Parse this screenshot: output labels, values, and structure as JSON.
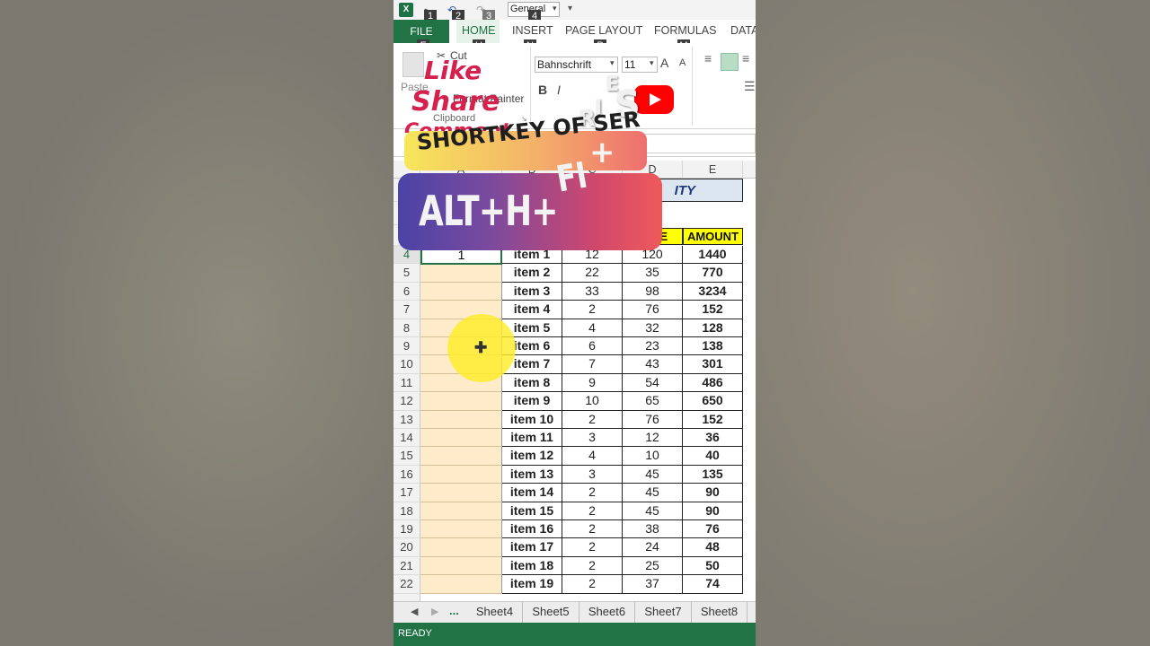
{
  "quick_access": {
    "app_icon": "X",
    "number_format": "General",
    "keytips": [
      "1",
      "2",
      "3",
      "4"
    ]
  },
  "tabs": [
    {
      "label": "FILE",
      "keytip": "F"
    },
    {
      "label": "HOME",
      "keytip": "H"
    },
    {
      "label": "INSERT",
      "keytip": "N"
    },
    {
      "label": "PAGE LAYOUT",
      "keytip": "P"
    },
    {
      "label": "FORMULAS",
      "keytip": "M"
    },
    {
      "label": "DATA",
      "keytip": ""
    }
  ],
  "ribbon": {
    "paste": "Paste",
    "cut": "Cut",
    "format_painter": "Format Painter",
    "clipboard": "Clipboard",
    "font_name": "Bahnschrift",
    "font_size": "11",
    "grow_font": "A",
    "shrink_font": "A",
    "bold": "B",
    "italic": "I"
  },
  "overlay": {
    "like": "Like",
    "share": "Share",
    "comment": "Comment",
    "series_letters": [
      "E",
      "S"
    ],
    "banner_small": "SHORTKEY OF SER",
    "series_r": "R",
    "series_i": "I",
    "banner_big": "ALT+H+",
    "fi": "FI",
    "plus": "+"
  },
  "columns": [
    "A",
    "B",
    "C",
    "D",
    "E"
  ],
  "title_fragment": "ITY",
  "headers": {
    "price": "CE",
    "amount": "AMOUNT"
  },
  "rows": [
    {
      "num": "4",
      "a": "1",
      "item": "item 1",
      "qty": "12",
      "price": "120",
      "amount": "1440"
    },
    {
      "num": "5",
      "a": "",
      "item": "item 2",
      "qty": "22",
      "price": "35",
      "amount": "770"
    },
    {
      "num": "6",
      "a": "",
      "item": "item 3",
      "qty": "33",
      "price": "98",
      "amount": "3234"
    },
    {
      "num": "7",
      "a": "",
      "item": "item 4",
      "qty": "2",
      "price": "76",
      "amount": "152"
    },
    {
      "num": "8",
      "a": "",
      "item": "item 5",
      "qty": "4",
      "price": "32",
      "amount": "128"
    },
    {
      "num": "9",
      "a": "",
      "item": "item 6",
      "qty": "6",
      "price": "23",
      "amount": "138"
    },
    {
      "num": "10",
      "a": "",
      "item": "item 7",
      "qty": "7",
      "price": "43",
      "amount": "301"
    },
    {
      "num": "11",
      "a": "",
      "item": "item 8",
      "qty": "9",
      "price": "54",
      "amount": "486"
    },
    {
      "num": "12",
      "a": "",
      "item": "item 9",
      "qty": "10",
      "price": "65",
      "amount": "650"
    },
    {
      "num": "13",
      "a": "",
      "item": "item 10",
      "qty": "2",
      "price": "76",
      "amount": "152"
    },
    {
      "num": "14",
      "a": "",
      "item": "item 11",
      "qty": "3",
      "price": "12",
      "amount": "36"
    },
    {
      "num": "15",
      "a": "",
      "item": "item 12",
      "qty": "4",
      "price": "10",
      "amount": "40"
    },
    {
      "num": "16",
      "a": "",
      "item": "item 13",
      "qty": "3",
      "price": "45",
      "amount": "135"
    },
    {
      "num": "17",
      "a": "",
      "item": "item 14",
      "qty": "2",
      "price": "45",
      "amount": "90"
    },
    {
      "num": "18",
      "a": "",
      "item": "item 15",
      "qty": "2",
      "price": "45",
      "amount": "90"
    },
    {
      "num": "19",
      "a": "",
      "item": "item 16",
      "qty": "2",
      "price": "38",
      "amount": "76"
    },
    {
      "num": "20",
      "a": "",
      "item": "item 17",
      "qty": "2",
      "price": "24",
      "amount": "48"
    },
    {
      "num": "21",
      "a": "",
      "item": "item 18",
      "qty": "2",
      "price": "25",
      "amount": "50"
    },
    {
      "num": "22",
      "a": "",
      "item": "item 19",
      "qty": "2",
      "price": "37",
      "amount": "74"
    }
  ],
  "sheets": [
    "Sheet4",
    "Sheet5",
    "Sheet6",
    "Sheet7",
    "Sheet8"
  ],
  "sheet_more": "...",
  "status": "READY",
  "colors": {
    "excel_green": "#217346",
    "highlight_yellow": "#ffff00",
    "col_a_fill": "#fdebc9"
  }
}
